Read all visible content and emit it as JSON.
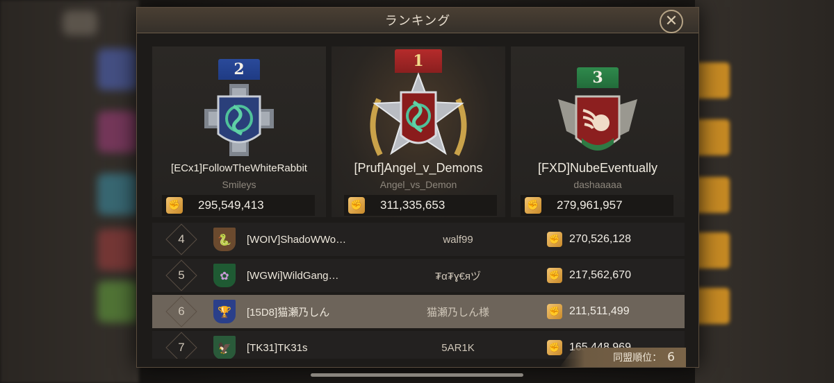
{
  "window": {
    "title": "ランキング"
  },
  "close_icon": "close-icon",
  "top3": [
    {
      "rank": "2",
      "alliance": "[ECx1]FollowTheWhiteRabbit",
      "leader": "Smileys",
      "score": "295,549,413",
      "ribbon_color": "#1f3b84",
      "banner_color": "#2a3f7a"
    },
    {
      "rank": "1",
      "alliance": "[Pruf]Angel_v_Demons",
      "leader": "Angel_vs_Demon",
      "score": "311,335,653",
      "ribbon_color": "#8a1f1f",
      "banner_color": "#8a1c1c"
    },
    {
      "rank": "3",
      "alliance": "[FXD]NubeEventually",
      "leader": "dashaaaaa",
      "score": "279,961,957",
      "ribbon_color": "#226b3a",
      "banner_color": "#8c1f1f"
    }
  ],
  "rows": [
    {
      "rank": "4",
      "alliance": "[WOIV]ShadoWWo…",
      "leader": "walf99",
      "score": "270,526,128",
      "flag_color": "#6b4a2e",
      "highlight": false
    },
    {
      "rank": "5",
      "alliance": "[WGWi]WildGang…",
      "leader": "₮α₮ɣ€яヅ",
      "score": "217,562,670",
      "flag_color": "#1f5a33",
      "highlight": false
    },
    {
      "rank": "6",
      "alliance": "[15D8]猫瀬乃しん",
      "leader": "猫瀬乃しん様",
      "score": "211,511,499",
      "flag_color": "#2a3f8a",
      "highlight": true
    },
    {
      "rank": "7",
      "alliance": "[TK31]TK31s",
      "leader": "5AR1K",
      "score": "165,448,969",
      "flag_color": "#2a5a3a",
      "highlight": false
    }
  ],
  "footer": {
    "label": "同盟順位：",
    "value": "6"
  },
  "colors": {
    "accent": "#e09a23",
    "highlight_row": "#6d645a"
  }
}
